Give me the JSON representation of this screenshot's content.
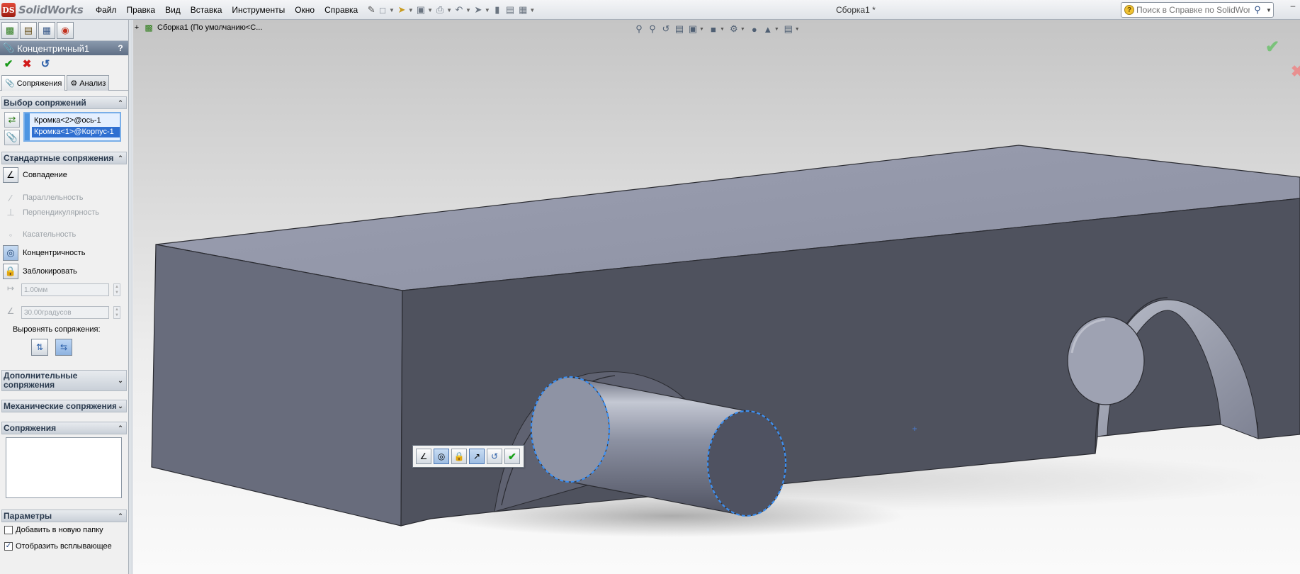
{
  "app": {
    "logo_mark": "DS",
    "logo_text": "SolidWorks",
    "document_title": "Сборка1 *"
  },
  "menu": {
    "items": [
      "Файл",
      "Правка",
      "Вид",
      "Вставка",
      "Инструменты",
      "Окно",
      "Справка"
    ]
  },
  "search": {
    "placeholder": "Поиск в Справке по SolidWorks"
  },
  "property_manager": {
    "title": "Концентричный1",
    "help_label": "?",
    "tabs": {
      "mates": "Сопряжения",
      "analysis": "Анализ"
    },
    "mate_selection": {
      "header": "Выбор сопряжений",
      "items": [
        "Кромка<2>@ось-1",
        "Кромка<1>@Корпус-1"
      ]
    },
    "standard_mates": {
      "header": "Стандартные сопряжения",
      "coincident": "Совпадение",
      "parallel": "Параллельность",
      "perpendicular": "Перпендикулярность",
      "tangent": "Касательность",
      "concentric": "Концентричность",
      "lock": "Заблокировать",
      "distance_value": "1.00мм",
      "angle_value": "30.00градусов",
      "align_label": "Выровнять сопряжения:"
    },
    "advanced_mates": {
      "header": "Дополнительные сопряжения"
    },
    "mechanical_mates": {
      "header": "Механические сопряжения"
    },
    "mates": {
      "header": "Сопряжения"
    },
    "options": {
      "header": "Параметры",
      "add_to_folder": "Добавить в новую папку",
      "show_popup": "Отобразить всплывающее"
    }
  },
  "viewport": {
    "tree_flyout": "Сборка1  (По умолчанию<С..."
  },
  "colors": {
    "selection_highlight": "#2f6fd1",
    "edge_highlight": "#3d8ff0",
    "model_top": "#9599ab",
    "model_front": "#4f525e"
  }
}
